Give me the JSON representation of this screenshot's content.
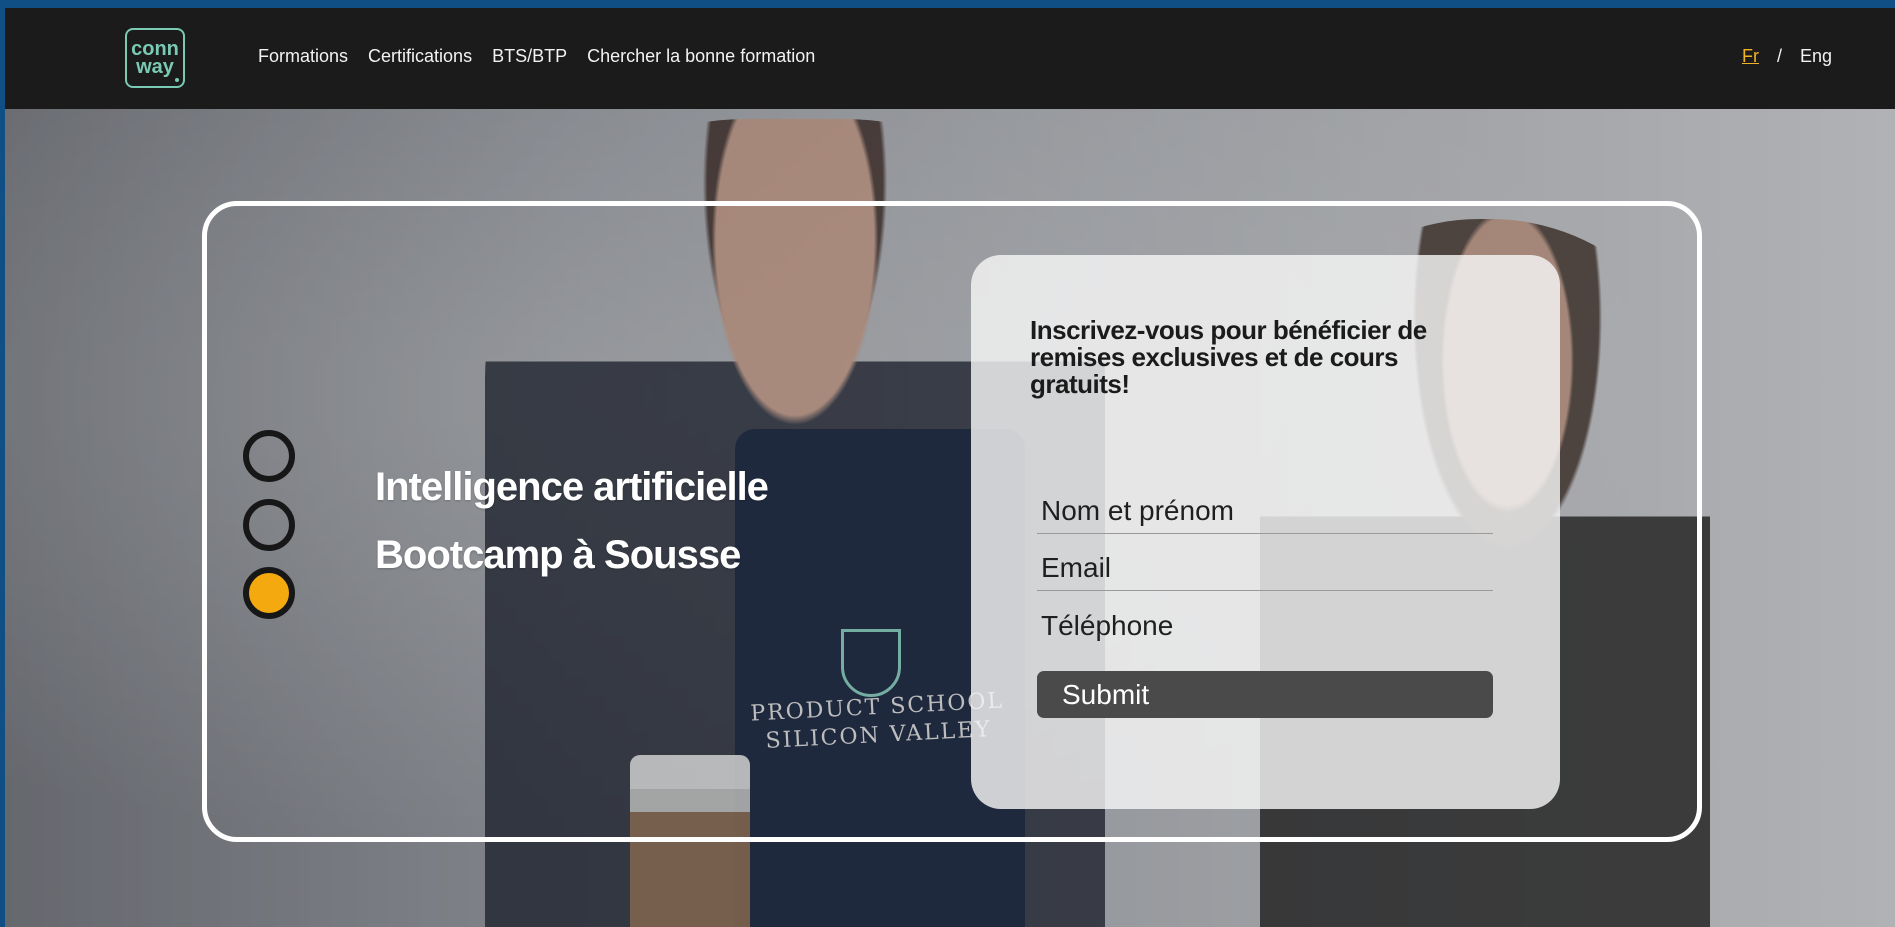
{
  "navbar": {
    "logo_text_line1": "conn",
    "logo_text_line2": "way",
    "links": [
      "Formations",
      "Certifications",
      "BTS/BTP",
      "Chercher la bonne formation"
    ],
    "lang_fr": "Fr",
    "lang_sep": "/",
    "lang_en": "Eng"
  },
  "hero": {
    "title_line1": "Intelligence artificielle",
    "title_line2": "Bootcamp à Sousse",
    "slides_total": 3,
    "active_slide": 3,
    "shirt_text_line1": "PRODUCT SCHOOL",
    "shirt_text_line2": "SILICON VALLEY"
  },
  "form": {
    "title": "Inscrivez-vous pour bénéficier de remises exclusives et de cours gratuits!",
    "name_placeholder": "Nom et prénom",
    "email_placeholder": "Email",
    "phone_placeholder": "Téléphone",
    "submit_label": "Submit"
  },
  "colors": {
    "accent": "#f4a90f",
    "brand": "#79c9b3",
    "nav_bg": "#1b1b1b"
  }
}
